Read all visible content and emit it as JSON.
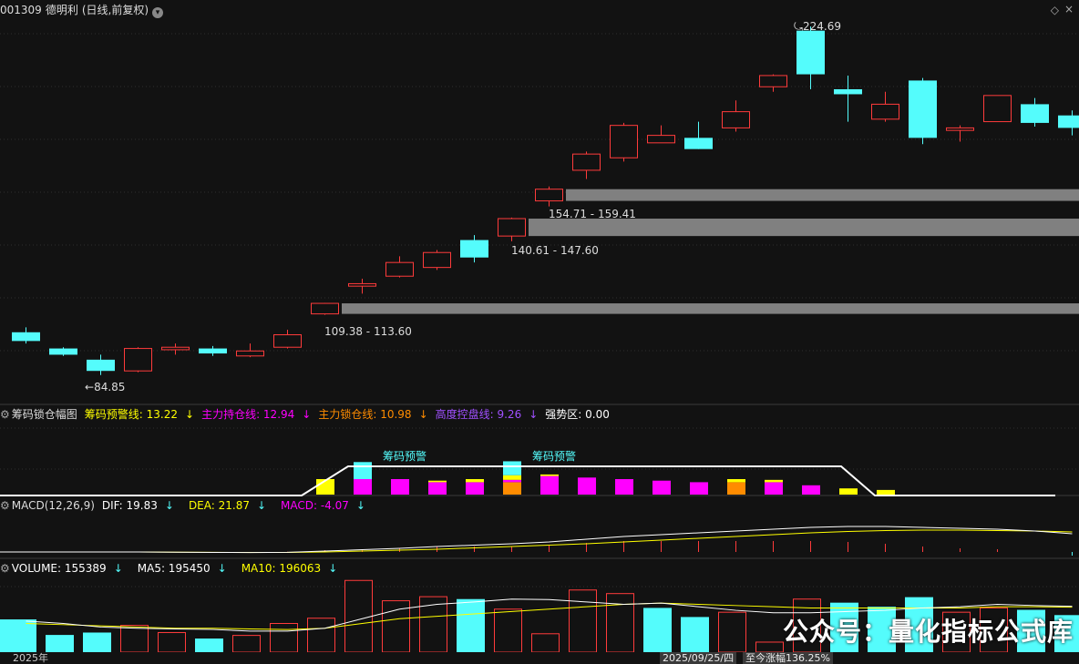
{
  "header": {
    "code": "001309",
    "name": "德明利",
    "period": "(日线,前复权)",
    "dropdown_icon": "chevron-down-icon",
    "diamond_icon": "diamond-icon",
    "close_icon": "close-icon"
  },
  "price_labels": {
    "high": "224.69",
    "low": "84.85",
    "zone1": "109.38 - 113.60",
    "zone2": "140.61 - 147.60",
    "zone3": "154.71 - 159.41"
  },
  "indicator_panel": {
    "name": "筹码锁仓幅图",
    "warn": "筹码预警线: 13.22",
    "hold": "主力持仓线: 12.94",
    "lock": "主力锁仓线: 10.98",
    "control": "高度控盘线: 9.26",
    "strong": "强势区: 0.00",
    "signal1": "筹码预警",
    "signal2": "筹码预警"
  },
  "macd_panel": {
    "name": "MACD(12,26,9)",
    "dif": "DIF: 19.83",
    "dea": "DEA: 21.87",
    "macd": "MACD: -4.07"
  },
  "volume_panel": {
    "volume": "VOLUME: 155389",
    "ma5": "MA5: 195450",
    "ma10": "MA10: 196063"
  },
  "footer": {
    "year": "2025年",
    "date": "2025/09/25/四",
    "change": "至今涨幅136.25%"
  },
  "watermark": "公众号：量化指标公式库",
  "colors": {
    "up": "#ff3b3b",
    "down": "#54fcfc",
    "yellow": "#ffff00",
    "magenta": "#ff00ff",
    "orange": "#ff8c00",
    "purple": "#a050ff",
    "zone": "#808080"
  },
  "chart_data": {
    "type": "candlestick",
    "candles": [
      {
        "o": 102.0,
        "c": 98.5,
        "h": 104.0,
        "l": 97.5
      },
      {
        "o": 95.5,
        "c": 93.0,
        "h": 96.0,
        "l": 92.5
      },
      {
        "o": 91.0,
        "c": 86.5,
        "h": 93.0,
        "l": 84.85
      },
      {
        "o": 86.5,
        "c": 95.5,
        "h": 96.0,
        "l": 86.0
      },
      {
        "o": 95.0,
        "c": 96.0,
        "h": 97.5,
        "l": 93.0
      },
      {
        "o": 95.5,
        "c": 93.5,
        "h": 96.5,
        "l": 92.5
      },
      {
        "o": 92.5,
        "c": 94.5,
        "h": 97.5,
        "l": 92.0
      },
      {
        "o": 96.0,
        "c": 101.0,
        "h": 103.0,
        "l": 95.5
      },
      {
        "o": 109.38,
        "c": 113.6,
        "h": 113.8,
        "l": 109.0
      },
      {
        "o": 120.5,
        "c": 121.5,
        "h": 123.5,
        "l": 117.5
      },
      {
        "o": 124.5,
        "c": 130.0,
        "h": 132.5,
        "l": 124.0
      },
      {
        "o": 128.0,
        "c": 134.0,
        "h": 135.0,
        "l": 127.0
      },
      {
        "o": 139.0,
        "c": 132.0,
        "h": 141.0,
        "l": 130.0
      },
      {
        "o": 140.61,
        "c": 147.6,
        "h": 148.0,
        "l": 138.5
      },
      {
        "o": 154.71,
        "c": 159.41,
        "h": 160.5,
        "l": 152.5
      },
      {
        "o": 167.0,
        "c": 173.5,
        "h": 174.5,
        "l": 163.5
      },
      {
        "o": 172.0,
        "c": 185.0,
        "h": 186.0,
        "l": 170.5
      },
      {
        "o": 178.0,
        "c": 181.0,
        "h": 185.0,
        "l": 178.0
      },
      {
        "o": 180.0,
        "c": 175.5,
        "h": 186.5,
        "l": 175.5
      },
      {
        "o": 184.0,
        "c": 190.5,
        "h": 195.0,
        "l": 182.5
      },
      {
        "o": 200.5,
        "c": 205.0,
        "h": 205.5,
        "l": 198.5
      },
      {
        "o": 223.0,
        "c": 205.5,
        "h": 224.69,
        "l": 199.5
      },
      {
        "o": 199.5,
        "c": 197.5,
        "h": 205.0,
        "l": 186.5
      },
      {
        "o": 187.5,
        "c": 193.5,
        "h": 198.5,
        "l": 186.5
      },
      {
        "o": 203.0,
        "c": 180.0,
        "h": 204.0,
        "l": 177.5
      },
      {
        "o": 183.0,
        "c": 184.0,
        "h": 185.0,
        "l": 178.5
      },
      {
        "o": 186.5,
        "c": 197.0,
        "h": 197.0,
        "l": 186.5
      },
      {
        "o": 193.5,
        "c": 186.0,
        "h": 196.0,
        "l": 184.5
      },
      {
        "o": 189.0,
        "c": 184.0,
        "h": 191.0,
        "l": 181.0
      }
    ],
    "zones": [
      {
        "low": 109.38,
        "high": 113.6,
        "start": 8
      },
      {
        "low": 140.61,
        "high": 147.6,
        "start": 13
      },
      {
        "low": 154.71,
        "high": 159.41,
        "start": 14
      }
    ],
    "ylim": [
      80,
      228
    ]
  },
  "chip_data": {
    "bars": [
      [],
      [],
      [],
      [],
      [],
      [],
      [],
      [],
      [
        [
          "#ffff00",
          1.0
        ]
      ],
      [
        [
          "#ff00ff",
          1.0
        ],
        [
          "#54fcfc",
          1.1
        ]
      ],
      [
        [
          "#ff00ff",
          1.0
        ]
      ],
      [
        [
          "#ff00ff",
          0.8
        ],
        [
          "#ffff00",
          0.1
        ]
      ],
      [
        [
          "#ff00ff",
          0.8
        ],
        [
          "#ffff00",
          0.2
        ]
      ],
      [
        [
          "#ff8c00",
          0.8
        ],
        [
          "#ff00ff",
          0.15
        ],
        [
          "#ffff00",
          0.3
        ],
        [
          "#54fcfc",
          0.9
        ]
      ],
      [
        [
          "#ff00ff",
          1.2
        ],
        [
          "#ffff00",
          0.1
        ]
      ],
      [
        [
          "#ff00ff",
          1.1
        ]
      ],
      [
        [
          "#ff00ff",
          1.0
        ]
      ],
      [
        [
          "#ff00ff",
          0.9
        ]
      ],
      [
        [
          "#ff00ff",
          0.8
        ]
      ],
      [
        [
          "#ff8c00",
          0.8
        ],
        [
          "#ffff00",
          0.2
        ]
      ],
      [
        [
          "#ff00ff",
          0.8
        ],
        [
          "#ffff00",
          0.15
        ]
      ],
      [
        [
          "#ff00ff",
          0.6
        ]
      ],
      [
        [
          "#ffff00",
          0.4
        ]
      ],
      [
        [
          "#ffff00",
          0.3
        ]
      ],
      [],
      [],
      [],
      [],
      []
    ]
  },
  "macd_data": {
    "dif": [
      0,
      0,
      0,
      0,
      -0.3,
      -0.5,
      -0.6,
      -0.4,
      1,
      2.5,
      4,
      6,
      7.5,
      9,
      11,
      14,
      17,
      19,
      21,
      23,
      25,
      27,
      28,
      28,
      27,
      26,
      25,
      23,
      20
    ],
    "dea": [
      0,
      0,
      0,
      0,
      -0.2,
      -0.4,
      -0.5,
      -0.5,
      0,
      1,
      2,
      3,
      4.5,
      6,
      7.5,
      9,
      11,
      13,
      15,
      17,
      19,
      21,
      22.5,
      23.5,
      24,
      24,
      23.5,
      23,
      22
    ],
    "hist": [
      0,
      0,
      0,
      0,
      -0.2,
      -0.2,
      -0.2,
      0.2,
      2,
      3,
      4,
      6,
      6,
      6,
      7,
      10,
      12,
      12,
      12,
      12,
      12,
      12,
      11,
      9,
      6,
      4,
      3,
      0,
      -4
    ]
  },
  "volume_data": {
    "bars": [
      {
        "v": 137,
        "up": false
      },
      {
        "v": 72,
        "up": false
      },
      {
        "v": 82,
        "up": false
      },
      {
        "v": 112,
        "up": true
      },
      {
        "v": 82,
        "up": true
      },
      {
        "v": 57,
        "up": false
      },
      {
        "v": 70,
        "up": true
      },
      {
        "v": 120,
        "up": true
      },
      {
        "v": 142,
        "up": true
      },
      {
        "v": 300,
        "up": true
      },
      {
        "v": 215,
        "up": true
      },
      {
        "v": 232,
        "up": true
      },
      {
        "v": 222,
        "up": false
      },
      {
        "v": 180,
        "up": true
      },
      {
        "v": 77,
        "up": true
      },
      {
        "v": 260,
        "up": true
      },
      {
        "v": 245,
        "up": true
      },
      {
        "v": 185,
        "up": false
      },
      {
        "v": 147,
        "up": false
      },
      {
        "v": 167,
        "up": true
      },
      {
        "v": 42,
        "up": true
      },
      {
        "v": 222,
        "up": true
      },
      {
        "v": 207,
        "up": false
      },
      {
        "v": 190,
        "up": false
      },
      {
        "v": 230,
        "up": false
      },
      {
        "v": 167,
        "up": true
      },
      {
        "v": 185,
        "up": true
      },
      {
        "v": 177,
        "up": false
      },
      {
        "v": 155,
        "up": false
      }
    ],
    "ma5": [
      130,
      120,
      105,
      100,
      97,
      95,
      88,
      88,
      100,
      140,
      180,
      200,
      210,
      222,
      220,
      210,
      200,
      205,
      190,
      175,
      165,
      165,
      170,
      175,
      185,
      190,
      200,
      195,
      192
    ],
    "ma10": [
      120,
      115,
      110,
      105,
      100,
      100,
      97,
      95,
      100,
      120,
      140,
      150,
      160,
      170,
      180,
      190,
      200,
      205,
      200,
      195,
      190,
      185,
      185,
      185,
      185,
      185,
      190,
      190,
      188
    ],
    "ymax": 320
  }
}
